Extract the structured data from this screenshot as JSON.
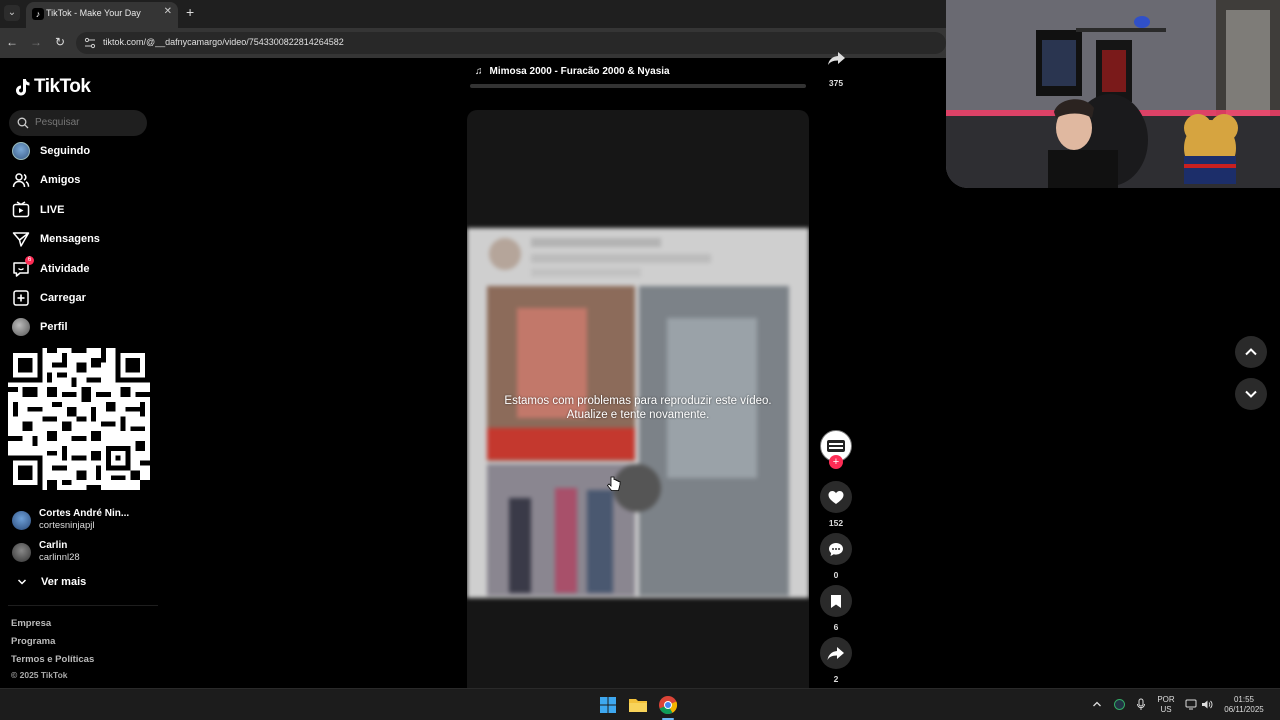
{
  "browser": {
    "tab_title": "TikTok - Make Your Day",
    "url": "tiktok.com/@__dafnycamargo/video/7543300822814264582"
  },
  "sidebar": {
    "logo": "TikTok",
    "search_placeholder": "Pesquisar",
    "nav": [
      {
        "label": "Seguindo",
        "icon": "following-avatar-icon"
      },
      {
        "label": "Amigos",
        "icon": "friends-icon"
      },
      {
        "label": "LIVE",
        "icon": "live-icon"
      },
      {
        "label": "Mensagens",
        "icon": "messages-icon"
      },
      {
        "label": "Atividade",
        "icon": "activity-icon",
        "badge": "6"
      },
      {
        "label": "Carregar",
        "icon": "upload-icon"
      },
      {
        "label": "Perfil",
        "icon": "profile-avatar-icon"
      }
    ],
    "following": [
      {
        "name": "Cortes André Nin...",
        "handle": "cortesninjapjl"
      },
      {
        "name": "Carlin",
        "handle": "carlinnl28"
      }
    ],
    "see_more": "Ver mais",
    "footer": [
      "Empresa",
      "Programa",
      "Termos e Políticas"
    ],
    "copyright": "© 2025 TikTok"
  },
  "feed": {
    "previous_music": "Mimosa 2000 - Furacão 2000 & Nyasia",
    "previous_share_count": "375",
    "error_line1": "Estamos com problemas para reproduzir este vídeo.",
    "error_line2": "Atualize e tente novamente.",
    "likes": "152",
    "comments": "0",
    "saves": "6",
    "shares": "2"
  },
  "taskbar": {
    "language": "POR",
    "layout": "US",
    "time": "01:55",
    "date": "06/11/2025"
  },
  "colors": {
    "accent": "#fe2c55",
    "background": "#000000"
  }
}
